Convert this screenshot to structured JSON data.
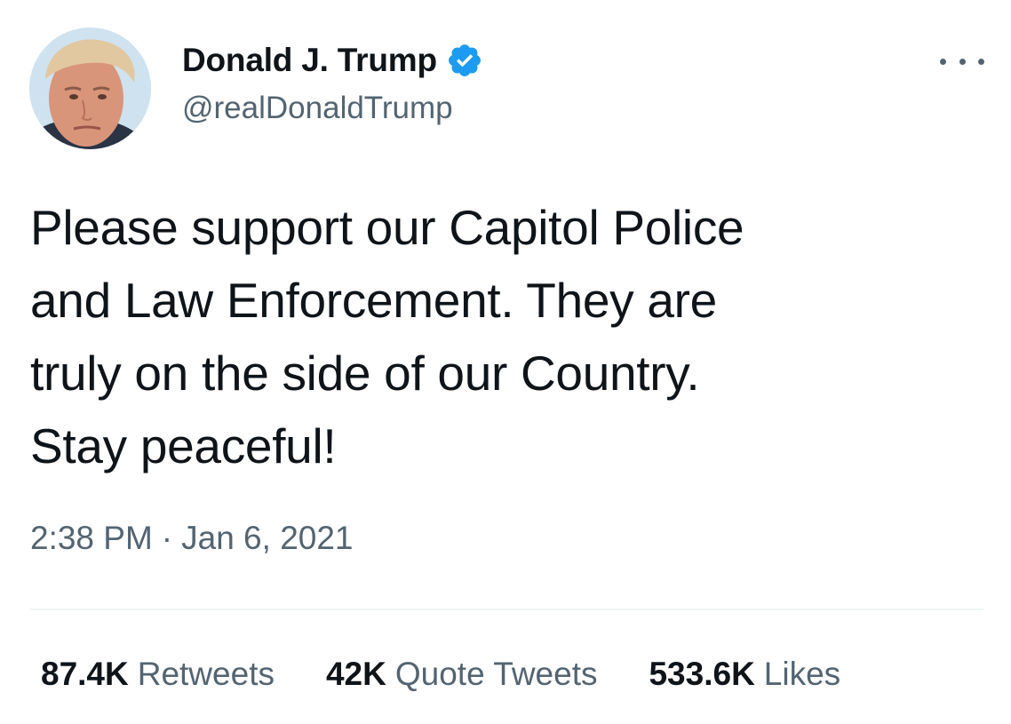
{
  "author": {
    "display_name": "Donald J. Trump",
    "handle": "@realDonaldTrump",
    "verified": true,
    "avatar_icon": "profile-photo"
  },
  "tweet": {
    "lines": [
      "Please support our Capitol Police",
      "and Law Enforcement. They are",
      "truly on the side of our Country.",
      "Stay peaceful!"
    ],
    "time": "2:38 PM",
    "separator": "·",
    "date": "Jan 6, 2021"
  },
  "stats": {
    "retweets_count": "87.4K",
    "retweets_label": "Retweets",
    "quotes_count": "42K",
    "quotes_label": "Quote Tweets",
    "likes_count": "533.6K",
    "likes_label": "Likes"
  },
  "colors": {
    "text_primary": "#0f1419",
    "text_secondary": "#536471",
    "verified_blue": "#1d9bf0",
    "divider": "#eff3f4"
  },
  "icons": {
    "verified": "verified-badge-icon",
    "more": "more-horizontal-icon"
  }
}
